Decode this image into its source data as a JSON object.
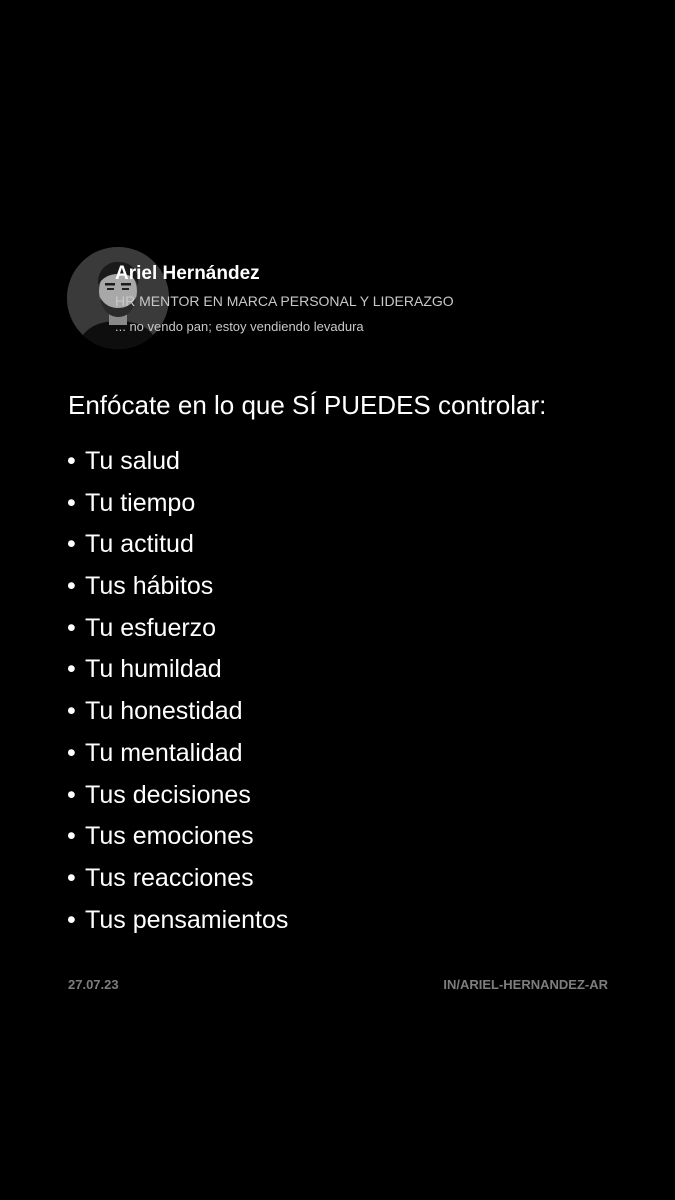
{
  "profile": {
    "name": "Ariel Hernández",
    "headline": "HR MENTOR EN MARCA PERSONAL Y LIDERAZGO",
    "tagline": "... no vendo pan; estoy vendiendo levadura",
    "avatar_icon": "person-photo"
  },
  "post": {
    "heading": "Enfócate en lo que SÍ PUEDES controlar:",
    "bullet_symbol": "•",
    "items": [
      "Tu salud",
      "Tu tiempo",
      "Tu actitud",
      "Tus hábitos",
      "Tu esfuerzo",
      "Tu humildad",
      "Tu honestidad",
      "Tu mentalidad",
      "Tus decisiones",
      "Tus emociones",
      "Tus reacciones",
      "Tus pensamientos"
    ]
  },
  "footer": {
    "date": "27.07.23",
    "handle": "IN/ARIEL-HERNANDEZ-AR"
  },
  "colors": {
    "background": "#000000",
    "primary_text": "#ffffff",
    "secondary_text": "#c9c9c9",
    "footer_text": "#7d7d7d"
  }
}
